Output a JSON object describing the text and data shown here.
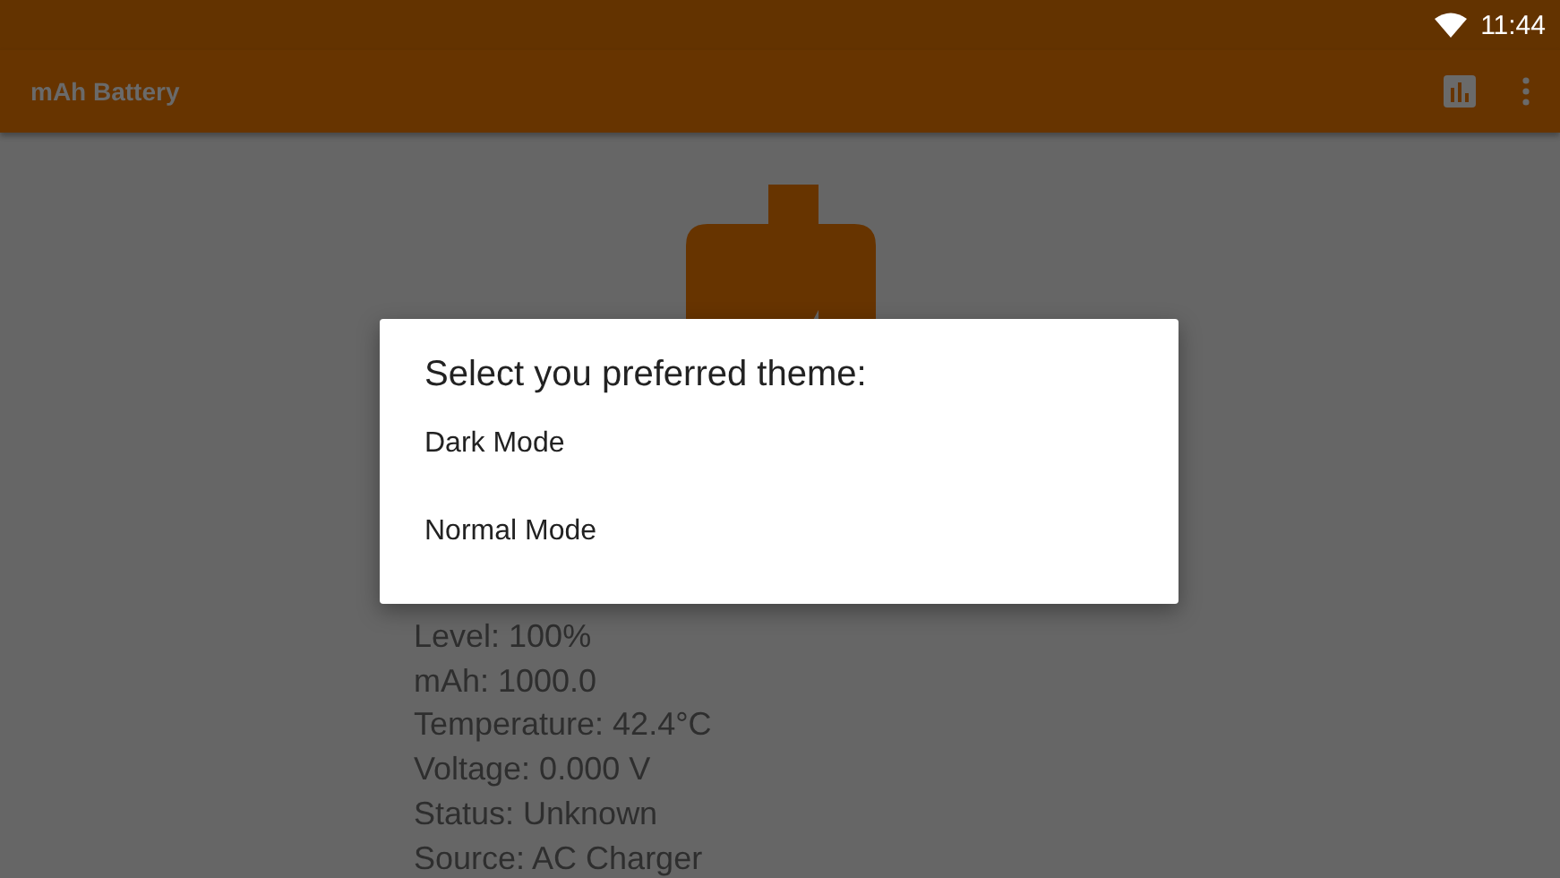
{
  "status_bar": {
    "time": "11:44"
  },
  "app_bar": {
    "title": "mAh Battery"
  },
  "battery_info": [
    "Level: 100%",
    "mAh: 1000.0",
    "Temperature: 42.4°C",
    "Voltage: 0.000 V",
    "Status: Unknown",
    "Source: AC Charger"
  ],
  "dialog": {
    "title": "Select you preferred theme:",
    "options": [
      "Dark Mode",
      "Normal Mode"
    ]
  }
}
